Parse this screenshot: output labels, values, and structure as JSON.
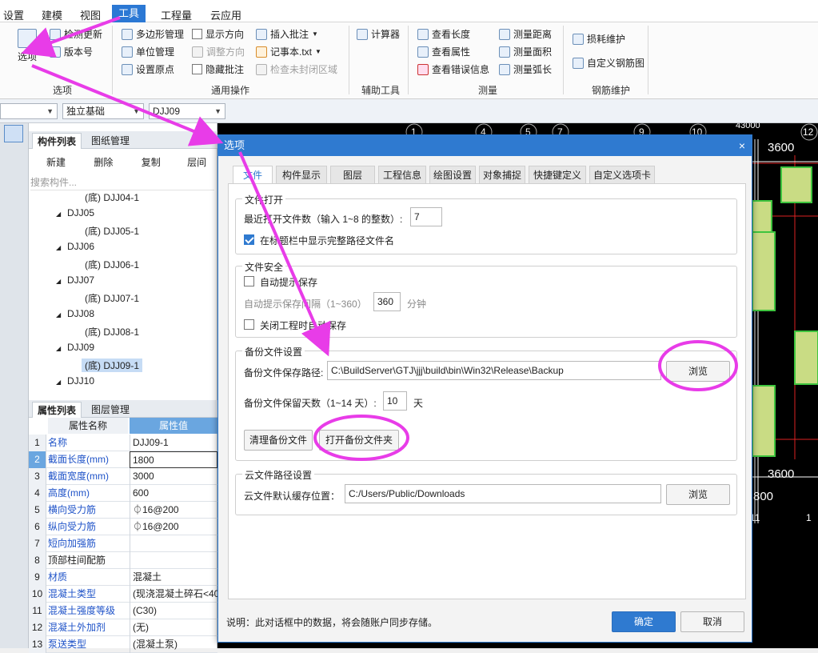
{
  "menu": {
    "items": [
      "设置",
      "建模",
      "视图",
      "工具",
      "工程量",
      "云应用"
    ],
    "active": "工具"
  },
  "ribbon": {
    "options_label": "选项",
    "check_update": "检测更新",
    "version": "版本号",
    "polygon_manage": "多边形管理",
    "unit_manage": "单位管理",
    "set_origin": "设置原点",
    "show_direction": "显示方向",
    "adjust_direction": "调整方向",
    "hide_annotation": "隐藏批注",
    "insert_annotation": "插入批注",
    "notepad": "记事本.txt",
    "check_unclosed": "检查未封闭区域",
    "calculator": "计算器",
    "view_length": "查看长度",
    "view_attr": "查看属性",
    "view_error": "查看错误信息",
    "measure_distance": "测量距离",
    "measure_area": "测量面积",
    "measure_arc": "测量弧长",
    "loss_maintain": "损耗维护",
    "custom_rebar": "自定义钢筋图",
    "group_options": "选项",
    "group_common": "通用操作",
    "group_aux": "辅助工具",
    "group_measure": "测量",
    "group_rebar": "钢筋维护"
  },
  "toolbar": {
    "combo_type": "独立基础",
    "combo_name": "DJJ09"
  },
  "component_panel": {
    "tab_list": "构件列表",
    "tab_drawing": "图纸管理",
    "btn_new": "新建",
    "btn_delete": "删除",
    "btn_copy": "复制",
    "btn_layer": "层间",
    "search_placeholder": "搜索构件...",
    "tree": [
      {
        "label": "(底) DJJ04-1",
        "level": 2
      },
      {
        "label": "DJJ05",
        "level": 1
      },
      {
        "label": "(底) DJJ05-1",
        "level": 2
      },
      {
        "label": "DJJ06",
        "level": 1
      },
      {
        "label": "(底) DJJ06-1",
        "level": 2
      },
      {
        "label": "DJJ07",
        "level": 1
      },
      {
        "label": "(底) DJJ07-1",
        "level": 2
      },
      {
        "label": "DJJ08",
        "level": 1
      },
      {
        "label": "(底) DJJ08-1",
        "level": 2
      },
      {
        "label": "DJJ09",
        "level": 1
      },
      {
        "label": "(底) DJJ09-1",
        "level": 2,
        "selected": true
      },
      {
        "label": "DJJ10",
        "level": 1
      }
    ]
  },
  "property_panel": {
    "tab_attr": "属性列表",
    "tab_layer": "图层管理",
    "col_name": "属性名称",
    "col_value": "属性值",
    "rows": [
      {
        "n": "1",
        "name": "名称",
        "value": "DJJ09-1"
      },
      {
        "n": "2",
        "name": "截面长度(mm)",
        "value": "1800"
      },
      {
        "n": "3",
        "name": "截面宽度(mm)",
        "value": "3000"
      },
      {
        "n": "4",
        "name": "高度(mm)",
        "value": "600"
      },
      {
        "n": "5",
        "name": "横向受力筋",
        "value": "⏀16@200"
      },
      {
        "n": "6",
        "name": "纵向受力筋",
        "value": "⏀16@200"
      },
      {
        "n": "7",
        "name": "短向加强筋",
        "value": ""
      },
      {
        "n": "8",
        "name": "顶部柱间配筋",
        "value": ""
      },
      {
        "n": "9",
        "name": "材质",
        "value": "混凝土"
      },
      {
        "n": "10",
        "name": "混凝土类型",
        "value": "(现浇混凝土碎石<40"
      },
      {
        "n": "11",
        "name": "混凝土强度等级",
        "value": "(C30)"
      },
      {
        "n": "12",
        "name": "混凝土外加剂",
        "value": "(无)"
      },
      {
        "n": "13",
        "name": "泵送类型",
        "value": "(混凝土泵)"
      }
    ]
  },
  "canvas": {
    "axis_labels": [
      "1",
      "4",
      "5",
      "7",
      "9",
      "10",
      "12",
      "11",
      "11",
      "1"
    ],
    "dims": [
      "3600",
      "3600",
      "800",
      "43000"
    ]
  },
  "dialog": {
    "title": "选项",
    "close": "×",
    "tabs": [
      "文件",
      "构件显示",
      "图层",
      "工程信息",
      "绘图设置",
      "对象捕捉",
      "快捷键定义",
      "自定义选项卡"
    ],
    "active_tab": "文件",
    "file_open": {
      "legend": "文件打开",
      "recent_label": "最近打开文件数（输入 1~8 的整数）:",
      "recent_value": "7",
      "show_path_label": "在标题栏中显示完整路径文件名",
      "show_path_checked": true
    },
    "file_safety": {
      "legend": "文件安全",
      "auto_prompt_label": "自动提示保存",
      "interval_label": "自动提示保存间隔（1~360）",
      "interval_value": "360",
      "interval_unit": "分钟",
      "close_auto_save_label": "关闭工程时自动保存"
    },
    "backup": {
      "legend": "备份文件设置",
      "path_label": "备份文件保存路径:",
      "path_value": "C:\\BuildServer\\GTJ\\jjj\\build\\bin\\Win32\\Release\\Backup",
      "browse": "浏览",
      "keep_days_label": "备份文件保留天数（1~14 天）:",
      "keep_days_value": "10",
      "keep_days_unit": "天",
      "clear_btn": "清理备份文件",
      "open_btn": "打开备份文件夹"
    },
    "cloud": {
      "legend": "云文件路径设置",
      "cache_label": "云文件默认缓存位置：",
      "cache_value": "C:/Users/Public/Downloads",
      "browse": "浏览"
    },
    "note": "说明：此对话框中的数据，将会随账户同步存储。",
    "ok": "确定",
    "cancel": "取消"
  },
  "annotation_color": "#e83ce8"
}
